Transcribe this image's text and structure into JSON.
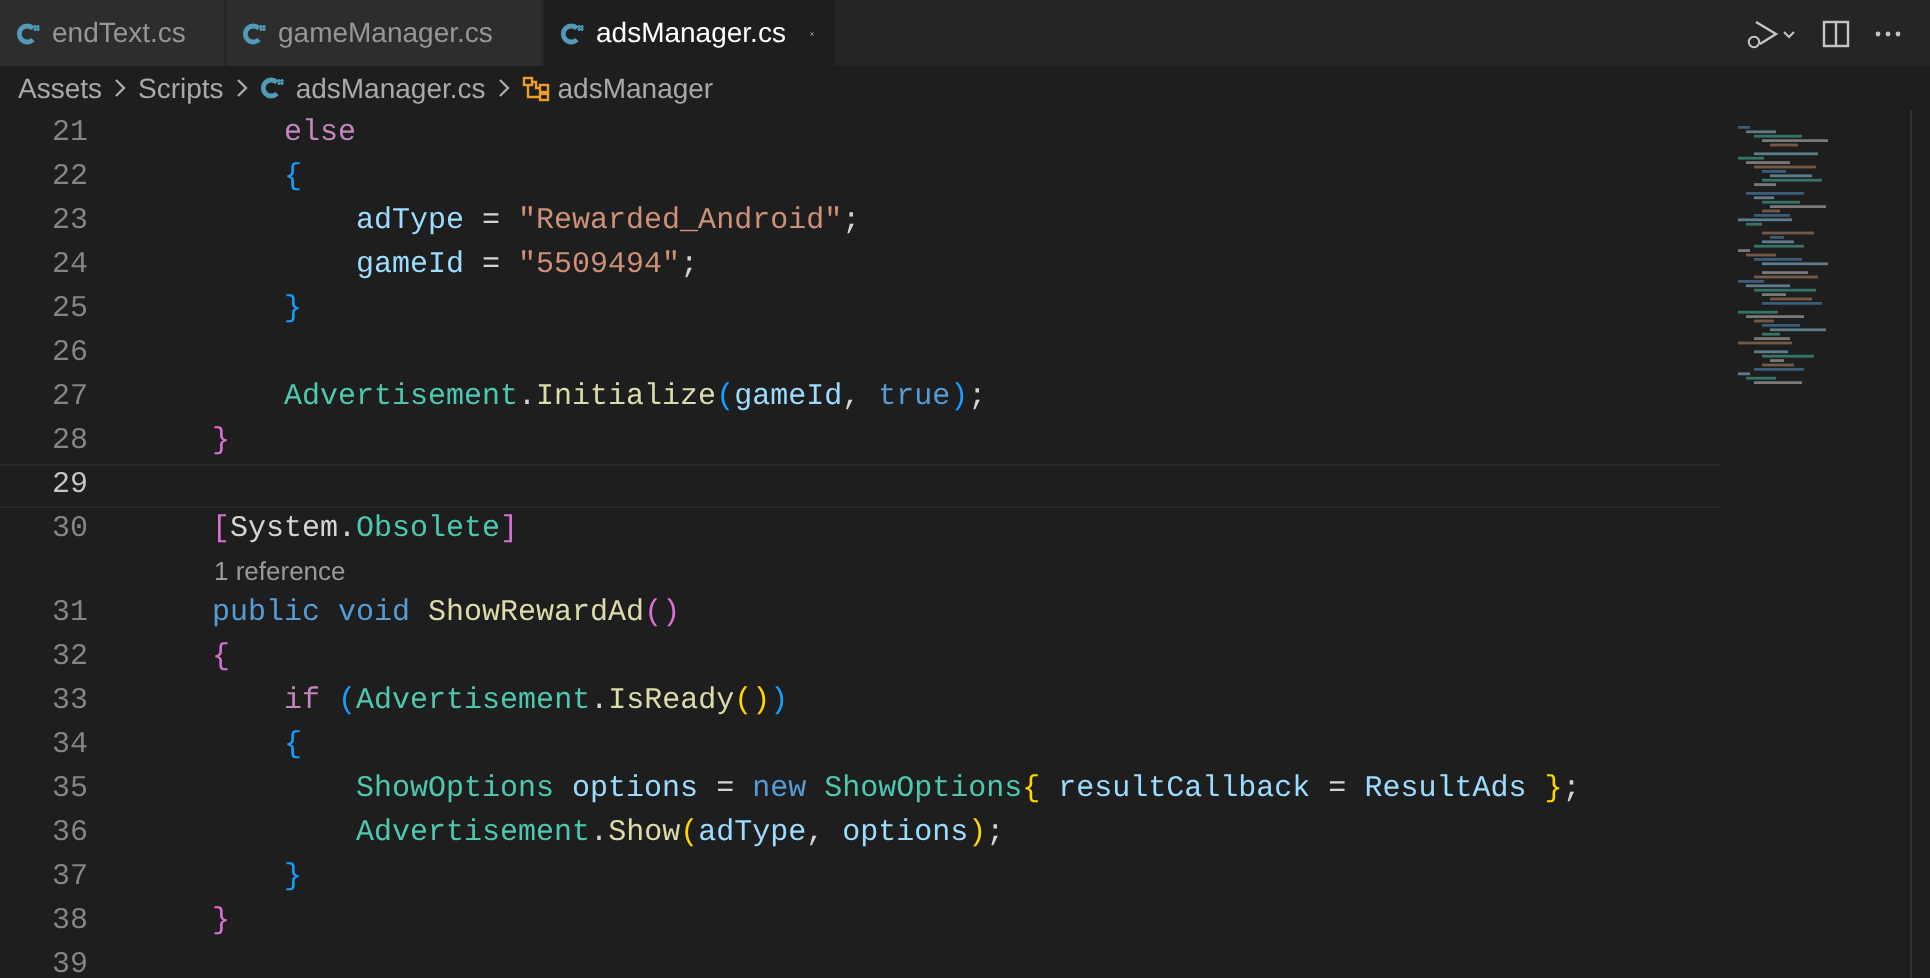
{
  "tabs": [
    {
      "label": "endText.cs",
      "selected": false
    },
    {
      "label": "gameManager.cs",
      "selected": false
    },
    {
      "label": "adsManager.cs",
      "selected": true
    }
  ],
  "breadcrumb": [
    {
      "label": "Assets",
      "kind": "folder"
    },
    {
      "label": "Scripts",
      "kind": "folder"
    },
    {
      "label": "adsManager.cs",
      "kind": "file"
    },
    {
      "label": "adsManager",
      "kind": "class"
    }
  ],
  "lines": [
    {
      "kind": "code",
      "number": "21",
      "current": false,
      "tokens": [
        {
          "text": "        else",
          "kind": "control"
        }
      ]
    },
    {
      "kind": "code",
      "number": "22",
      "current": false,
      "tokens": [
        {
          "text": "        {",
          "kind": "b3"
        }
      ]
    },
    {
      "kind": "code",
      "number": "23",
      "current": false,
      "tokens": [
        {
          "text": "            adType",
          "kind": "var"
        },
        {
          "text": " = ",
          "kind": "plain"
        },
        {
          "text": "\"Rewarded_Android\"",
          "kind": "string"
        },
        {
          "text": ";",
          "kind": "plain"
        }
      ]
    },
    {
      "kind": "code",
      "number": "24",
      "current": false,
      "tokens": [
        {
          "text": "            gameId",
          "kind": "var"
        },
        {
          "text": " = ",
          "kind": "plain"
        },
        {
          "text": "\"5509494\"",
          "kind": "string"
        },
        {
          "text": ";",
          "kind": "plain"
        }
      ]
    },
    {
      "kind": "code",
      "number": "25",
      "current": false,
      "tokens": [
        {
          "text": "        }",
          "kind": "b3"
        }
      ]
    },
    {
      "kind": "code",
      "number": "26",
      "current": false
    },
    {
      "kind": "code",
      "number": "27",
      "current": false,
      "tokens": [
        {
          "text": "        Advertisement",
          "kind": "type"
        },
        {
          "text": ".",
          "kind": "plain"
        },
        {
          "text": "Initialize",
          "kind": "func"
        },
        {
          "text": "(",
          "kind": "b3"
        },
        {
          "text": "gameId",
          "kind": "var"
        },
        {
          "text": ", ",
          "kind": "plain"
        },
        {
          "text": "true",
          "kind": "keyword"
        },
        {
          "text": ")",
          "kind": "b3"
        },
        {
          "text": ";",
          "kind": "plain"
        }
      ]
    },
    {
      "kind": "code",
      "number": "28",
      "current": false,
      "tokens": [
        {
          "text": "    }",
          "kind": "b2"
        }
      ]
    },
    {
      "kind": "code",
      "number": "29",
      "current": true
    },
    {
      "kind": "code",
      "number": "30",
      "current": false,
      "tokens": [
        {
          "text": "    [",
          "kind": "b2"
        },
        {
          "text": "System.",
          "kind": "plain"
        },
        {
          "text": "Obsolete",
          "kind": "type"
        },
        {
          "text": "]",
          "kind": "b2"
        }
      ]
    },
    {
      "kind": "codelens",
      "text": "1 reference"
    },
    {
      "kind": "code",
      "number": "31",
      "current": false,
      "tokens": [
        {
          "text": "    public void ",
          "kind": "keyword"
        },
        {
          "text": "ShowRewardAd",
          "kind": "func"
        },
        {
          "text": "()",
          "kind": "b2"
        }
      ]
    },
    {
      "kind": "code",
      "number": "32",
      "current": false,
      "tokens": [
        {
          "text": "    {",
          "kind": "b2"
        }
      ]
    },
    {
      "kind": "code",
      "number": "33",
      "current": false,
      "tokens": [
        {
          "text": "        if ",
          "kind": "control"
        },
        {
          "text": "(",
          "kind": "b3"
        },
        {
          "text": "Advertisement",
          "kind": "type"
        },
        {
          "text": ".",
          "kind": "plain"
        },
        {
          "text": "IsReady",
          "kind": "func"
        },
        {
          "text": "()",
          "kind": "b1"
        },
        {
          "text": ")",
          "kind": "b3"
        }
      ]
    },
    {
      "kind": "code",
      "number": "34",
      "current": false,
      "tokens": [
        {
          "text": "        {",
          "kind": "b3"
        }
      ]
    },
    {
      "kind": "code",
      "number": "35",
      "current": false,
      "tokens": [
        {
          "text": "            ShowOptions ",
          "kind": "type"
        },
        {
          "text": "options",
          "kind": "var"
        },
        {
          "text": " = ",
          "kind": "plain"
        },
        {
          "text": "new ",
          "kind": "keyword"
        },
        {
          "text": "ShowOptions",
          "kind": "type"
        },
        {
          "text": "{ ",
          "kind": "b1"
        },
        {
          "text": "resultCallback",
          "kind": "var"
        },
        {
          "text": " = ",
          "kind": "plain"
        },
        {
          "text": "ResultAds ",
          "kind": "var"
        },
        {
          "text": "}",
          "kind": "b1"
        },
        {
          "text": ";",
          "kind": "plain"
        }
      ]
    },
    {
      "kind": "code",
      "number": "36",
      "current": false,
      "tokens": [
        {
          "text": "            Advertisement",
          "kind": "type"
        },
        {
          "text": ".",
          "kind": "plain"
        },
        {
          "text": "Show",
          "kind": "func"
        },
        {
          "text": "(",
          "kind": "b1"
        },
        {
          "text": "adType",
          "kind": "var"
        },
        {
          "text": ", ",
          "kind": "plain"
        },
        {
          "text": "options",
          "kind": "var"
        },
        {
          "text": ")",
          "kind": "b1"
        },
        {
          "text": ";",
          "kind": "plain"
        }
      ]
    },
    {
      "kind": "code",
      "number": "37",
      "current": false,
      "tokens": [
        {
          "text": "        }",
          "kind": "b3"
        }
      ]
    },
    {
      "kind": "code",
      "number": "38",
      "current": false,
      "tokens": [
        {
          "text": "    }",
          "kind": "b2"
        }
      ]
    },
    {
      "kind": "code",
      "number": "39",
      "current": false
    }
  ]
}
